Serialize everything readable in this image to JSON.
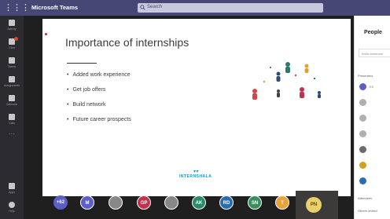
{
  "window": {
    "app_title": "Microsoft Teams",
    "search_placeholder": "Search"
  },
  "appbar": {
    "items": [
      {
        "label": "Activity",
        "icon": "bell-icon"
      },
      {
        "label": "Chat",
        "icon": "chat-icon"
      },
      {
        "label": "Teams",
        "icon": "teams-icon"
      },
      {
        "label": "Assignments",
        "icon": "assignments-icon"
      },
      {
        "label": "Calendar",
        "icon": "calendar-icon"
      },
      {
        "label": "Calls",
        "icon": "phone-icon"
      }
    ],
    "more": "···",
    "bottom_items": [
      {
        "label": "Apps",
        "icon": "apps-icon"
      },
      {
        "label": "Help",
        "icon": "help-icon"
      }
    ]
  },
  "slide": {
    "title": "Importance of internships",
    "bullets": [
      "Added work experience",
      "Get job offers",
      "Build network",
      "Future career prospects"
    ],
    "logo_text": "INTERNSHALA",
    "logo_color": "#1295c9"
  },
  "participants": {
    "overflow": "+62",
    "avatars": [
      {
        "initials": "M",
        "color": "#5b5fc7"
      },
      {
        "initials": "",
        "color": "#8a8886",
        "icon": "photo-avatar"
      },
      {
        "initials": "GP",
        "color": "#c4314b"
      },
      {
        "initials": "",
        "color": "#8a8886",
        "icon": "photo-avatar"
      },
      {
        "initials": "AK",
        "color": "#2b8a6e"
      },
      {
        "initials": "RD",
        "color": "#2b6cb0"
      },
      {
        "initials": "SN",
        "color": "#3a8f5c"
      },
      {
        "initials": "T",
        "color": "#e8a33a"
      }
    ],
    "active_initials": "PN"
  },
  "people_panel": {
    "title": "People",
    "invite_placeholder": "Invite someone",
    "presenters_label": "Presenters",
    "attendees_label": "Attendees",
    "others_label": "Others invited",
    "rows": [
      "EK",
      "",
      "",
      "",
      "",
      "",
      "",
      ""
    ]
  },
  "colors": {
    "titlebar": "#464775",
    "appbar": "#2b2b30",
    "stage": "#1f1f1f"
  }
}
